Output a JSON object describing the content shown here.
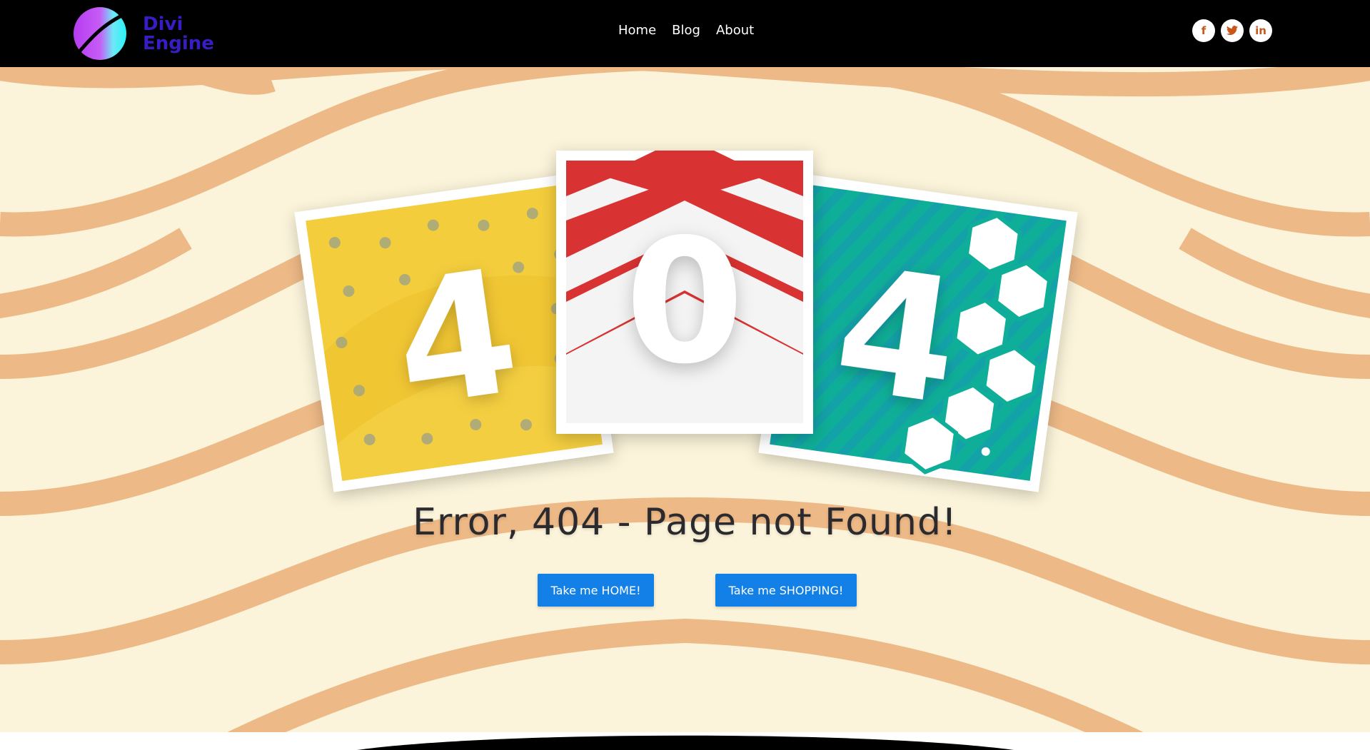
{
  "brand": {
    "line1": "Divi",
    "line2": "Engine"
  },
  "nav": {
    "items": [
      "Home",
      "Blog",
      "About"
    ]
  },
  "social": [
    {
      "icon": "facebook-icon",
      "glyph": "f"
    },
    {
      "icon": "twitter-icon",
      "glyph": "t"
    },
    {
      "icon": "linkedin-icon",
      "glyph": "in"
    }
  ],
  "cards": {
    "left_digit": "4",
    "middle_digit": "0",
    "right_digit": "4"
  },
  "main": {
    "heading": "Error, 404 - Page not Found!",
    "home_button": "Take me HOME!",
    "shop_button": "Take me SHOPPING!"
  },
  "colors": {
    "accent_button": "#1280e6",
    "background": "#fbf4da",
    "stripe": "#edb986",
    "topbar": "#000000",
    "social_icon": "#c7571a",
    "card_yellow": "#f3cd3c",
    "card_red": "#d93232",
    "card_teal": "#10b3a1"
  }
}
